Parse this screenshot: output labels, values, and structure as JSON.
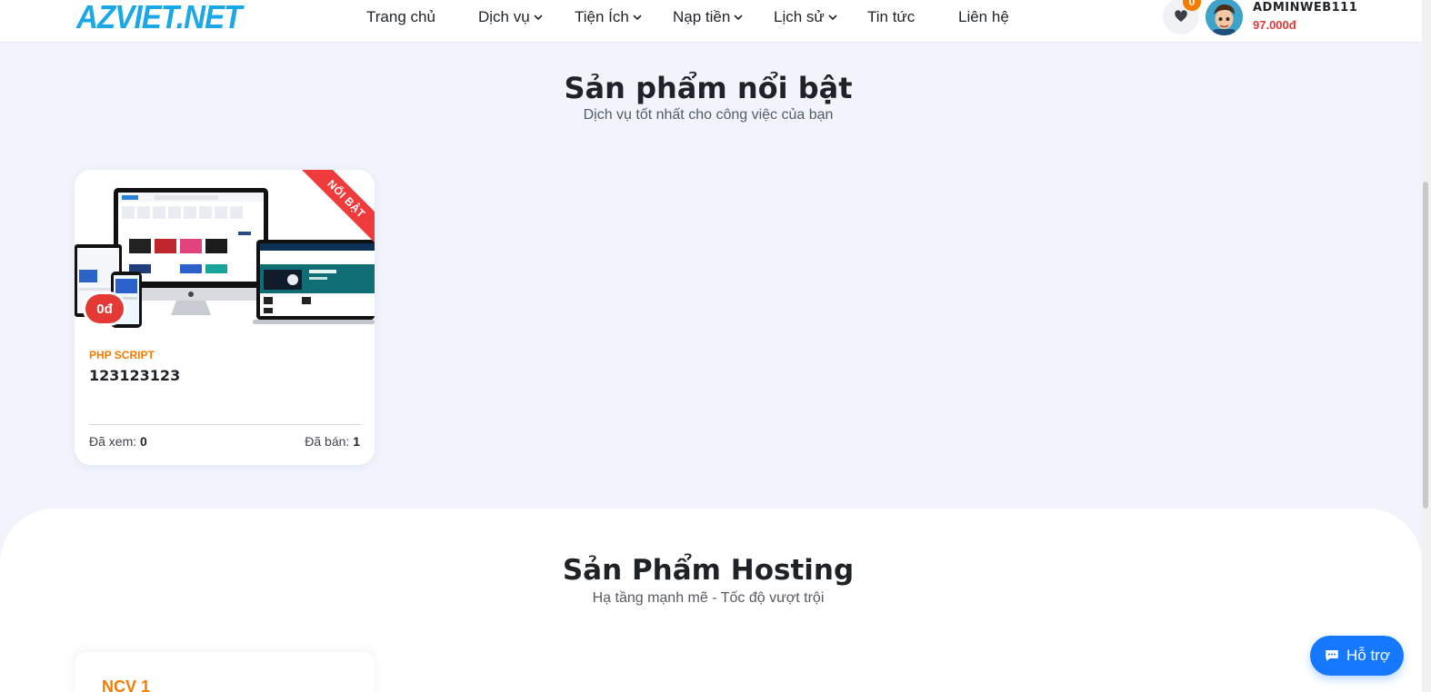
{
  "brand": {
    "logo_text": "AZVIET.NET",
    "logo_color": "#1ba8e6"
  },
  "nav": {
    "items": [
      {
        "label": "Trang chủ",
        "has_dropdown": false
      },
      {
        "label": "Dịch vụ",
        "has_dropdown": true
      },
      {
        "label": "Tiện Ích",
        "has_dropdown": true
      },
      {
        "label": "Nạp tiền",
        "has_dropdown": true
      },
      {
        "label": "Lịch sử",
        "has_dropdown": true
      },
      {
        "label": "Tin tức",
        "has_dropdown": false
      },
      {
        "label": "Liên hệ",
        "has_dropdown": false
      }
    ]
  },
  "header": {
    "favorites_count": "0",
    "favorites_icon": "heart-icon",
    "user": {
      "name": "ADMINWEB111",
      "balance": "97.000đ"
    }
  },
  "featured": {
    "title": "Sản phẩm nổi bật",
    "subtitle": "Dịch vụ tốt nhất cho công việc của bạn",
    "products": [
      {
        "ribbon": "NỔI BẬT",
        "price": "0đ",
        "category": "PHP SCRIPT",
        "name": "123123123",
        "views_label": "Đã xem:",
        "views": "0",
        "sold_label": "Đã bán:",
        "sold": "1"
      }
    ]
  },
  "hosting": {
    "title": "Sản Phẩm Hosting",
    "subtitle": "Hạ tầng mạnh mẽ - Tốc độ vượt trội",
    "first_card_title": "NCV 1"
  },
  "support": {
    "label": "Hỗ trợ",
    "icon": "chat-icon"
  },
  "colors": {
    "accent_orange": "#f57c00",
    "accent_red": "#e53935",
    "support_blue": "#1677ff",
    "page_bg": "#f1f4fc"
  }
}
